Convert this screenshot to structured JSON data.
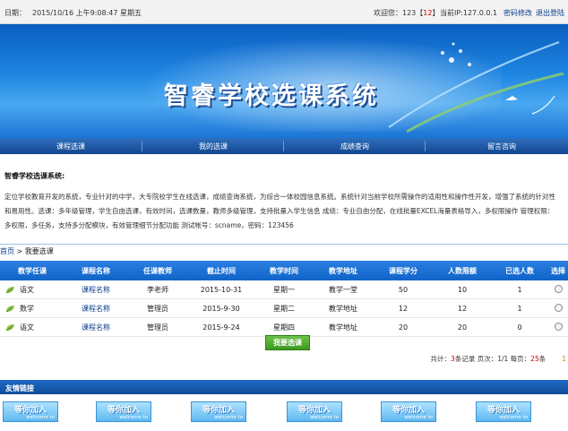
{
  "topbar": {
    "date_label": "日期：",
    "date_value": "2015/10/16 上午9:08:47 星期五",
    "welcome_prefix": "欢迎您：123【",
    "welcome_count": "12",
    "welcome_suffix": "】",
    "ip_text": "当前IP:127.0.0.1",
    "change_password": "密码修改",
    "logout": "退出登陆"
  },
  "banner": {
    "title": "智睿学校选课系统"
  },
  "nav": {
    "items": [
      "课程选课",
      "我的选课",
      "成绩查询",
      "留言咨询"
    ]
  },
  "intro": {
    "heading": "智睿学校选课系统:",
    "lines": [
      "定位学校教育开发的系统，专业针对的中学，大专院校学生在线选课，成绩查询系统，为综合一体校园信息系统。系统针对当前学校所需操作的适用性和操作性开发，增强了系统的针对性",
      "和易用性。选课：多年级管理，学生自由选课，有效时间，选课数量，教师多级管理，支持批量入学生信息 成绩：专业自由分配，在线批量EXCEL海量表格导入，多权限操作 管理权限：",
      "多权限，多任务，支持多分配模块，有效管理细节分配功能 测试帐号：scname，密码：123456"
    ]
  },
  "breadcrumb": {
    "home": "首页",
    "arrow": " > ",
    "current": "我要选课"
  },
  "table": {
    "headers": [
      "教学任课",
      "课程名称",
      "任课教师",
      "截止时间",
      "教学时间",
      "教学地址",
      "课程学分",
      "人数限额",
      "已选人数",
      "选择"
    ],
    "rows": [
      [
        "语文",
        "课程名称",
        "李老师",
        "2015-10-31",
        "星期一",
        "教学一堂",
        "50",
        "10",
        "1"
      ],
      [
        "数学",
        "课程名称",
        "管理员",
        "2015-9-30",
        "星期二",
        "教学地址",
        "12",
        "12",
        "1"
      ],
      [
        "语文",
        "课程名称",
        "管理员",
        "2015-9-24",
        "星期四",
        "教学地址",
        "20",
        "20",
        "0"
      ]
    ]
  },
  "submit_label": "我要选课",
  "pager": {
    "total_prefix": "共计：",
    "total_count": "3",
    "total_suffix": "条记录 页次：",
    "page": "1/1",
    "per_prefix": " 每页：",
    "per_count": "25",
    "per_suffix": "条",
    "trail": "1"
  },
  "friend_links": {
    "title": "友情链接",
    "logo_big": "等你加入",
    "logo_small": "welcome to"
  },
  "colors": {
    "primary_blue": "#1064c8",
    "nav_blue": "#12468e",
    "accent_red": "#d40000",
    "button_green": "#3d9a1e"
  }
}
